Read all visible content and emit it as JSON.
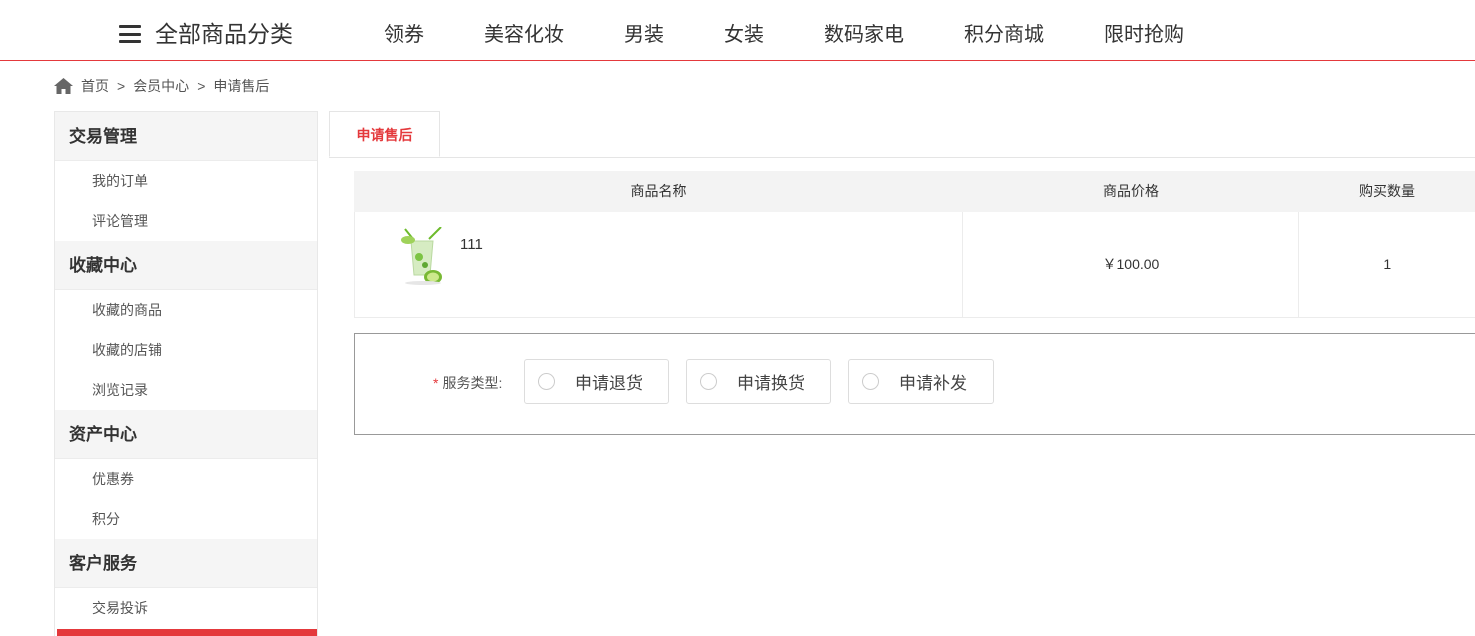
{
  "nav": {
    "category_label": "全部商品分类",
    "links": [
      "领券",
      "美容化妆",
      "男装",
      "女装",
      "数码家电",
      "积分商城",
      "限时抢购"
    ]
  },
  "breadcrumb": {
    "home": "首页",
    "separator": ">",
    "member": "会员中心",
    "current": "申请售后"
  },
  "sidebar": {
    "groups": [
      {
        "title": "交易管理",
        "items": [
          "我的订单",
          "评论管理"
        ]
      },
      {
        "title": "收藏中心",
        "items": [
          "收藏的商品",
          "收藏的店铺",
          "浏览记录"
        ]
      },
      {
        "title": "资产中心",
        "items": [
          "优惠券",
          "积分"
        ]
      },
      {
        "title": "客户服务",
        "items": [
          "交易投诉"
        ]
      }
    ]
  },
  "tab": {
    "label": "申请售后"
  },
  "table": {
    "headers": [
      "商品名称",
      "商品价格",
      "购买数量"
    ],
    "row": {
      "name": "111",
      "price": "￥100.00",
      "quantity": "1"
    }
  },
  "service": {
    "required_mark": "*",
    "label": "服务类型:",
    "options": [
      "申请退货",
      "申请换货",
      "申请补发"
    ]
  },
  "colors": {
    "accent": "#e4393c"
  }
}
